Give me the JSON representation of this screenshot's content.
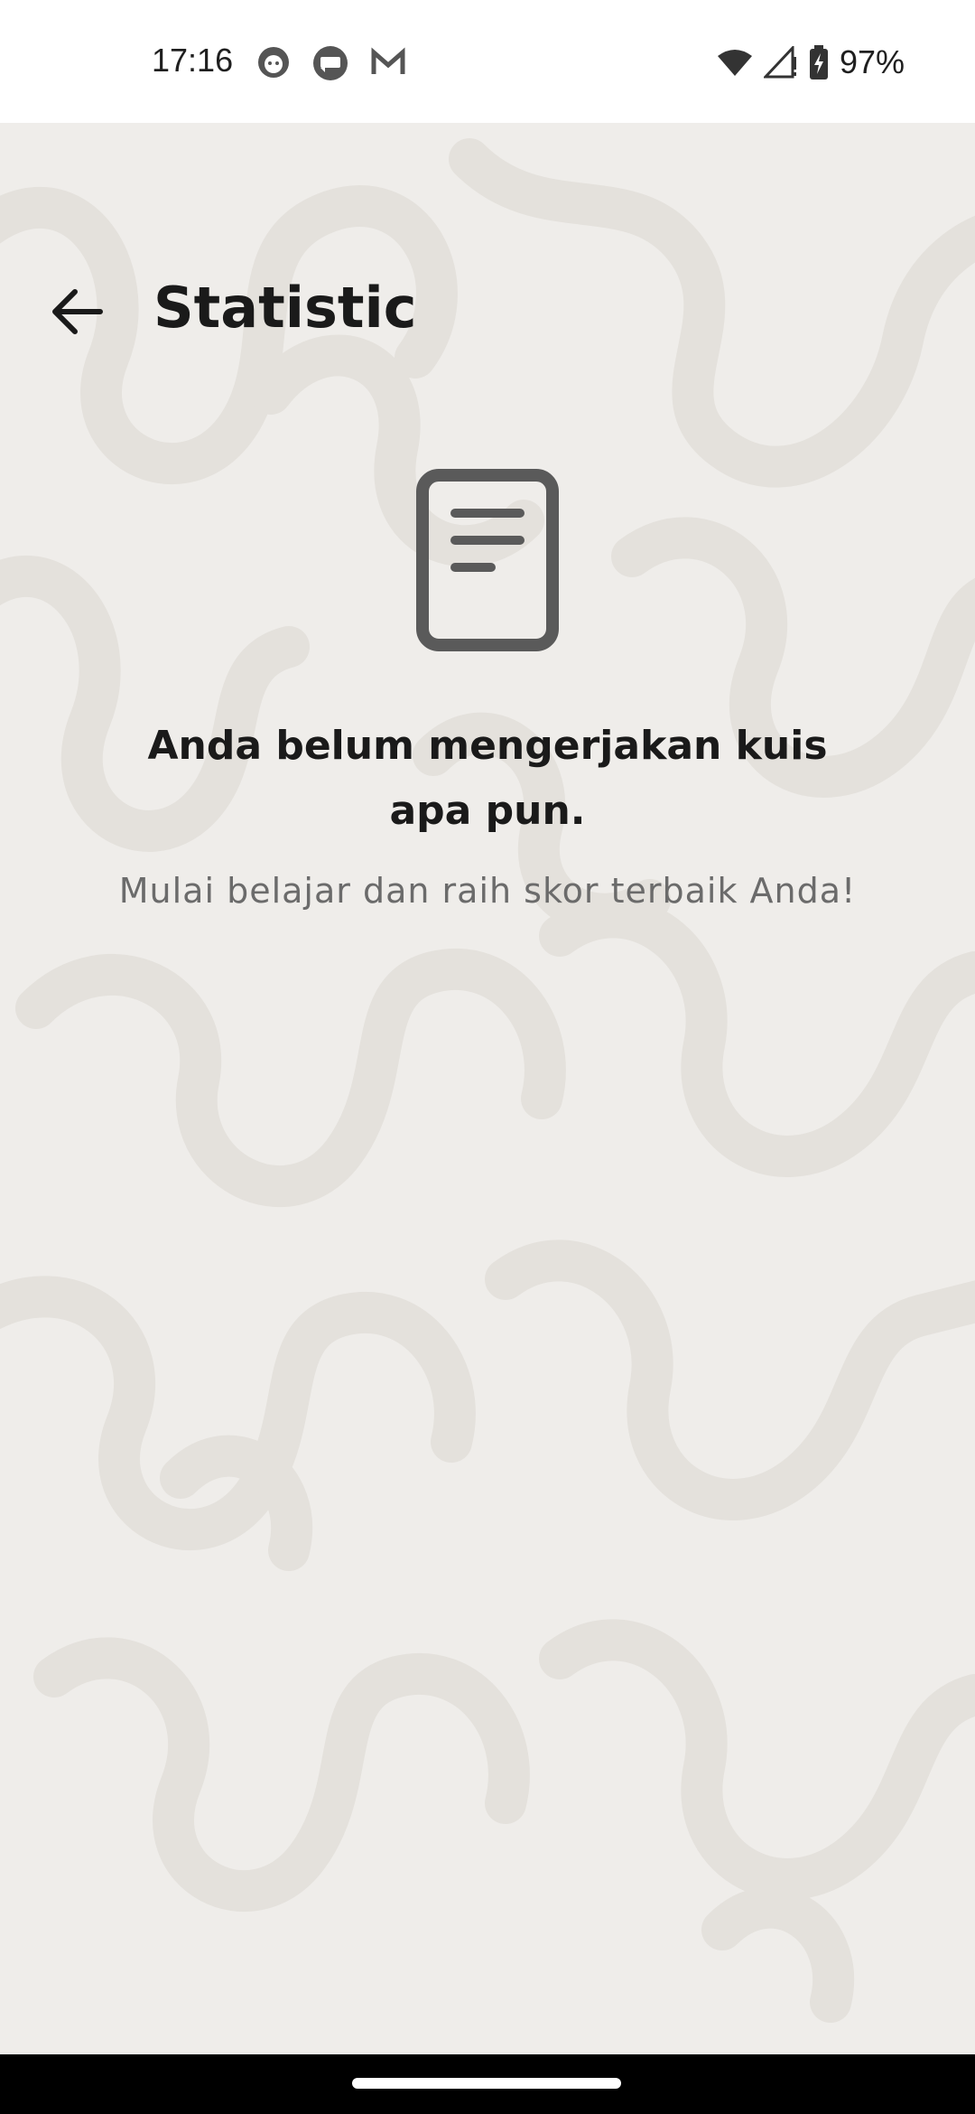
{
  "status_bar": {
    "time": "17:16",
    "battery": "97%"
  },
  "header": {
    "title": "Statistic"
  },
  "empty_state": {
    "title": "Anda belum mengerjakan kuis apa pun.",
    "subtitle": "Mulai belajar dan raih skor terbaik Anda!"
  },
  "colors": {
    "background": "#efedea",
    "pattern": "#e4e1dc",
    "title_text": "#1a1a1a",
    "subtitle_text": "#6b6b6b",
    "icon": "#5a5a5a"
  },
  "icons": {
    "back": "arrow-left-icon",
    "empty": "document-icon"
  }
}
